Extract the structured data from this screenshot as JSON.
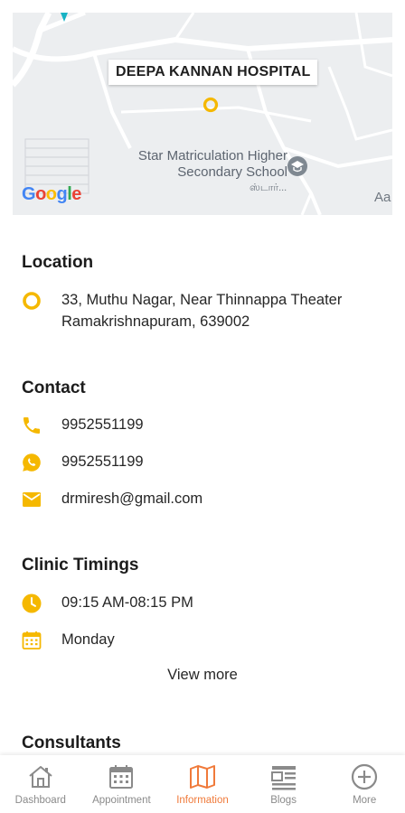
{
  "map": {
    "hospital_label": "DEEPA KANNAN HOSPITAL",
    "school_line1": "Star Matriculation Higher",
    "school_line2": "Secondary School",
    "school_tamil": "ஸ்டார்...",
    "edge_label": "Aa",
    "google": [
      "G",
      "o",
      "o",
      "g",
      "l",
      "e"
    ]
  },
  "location": {
    "title": "Location",
    "address_line1": "33, Muthu Nagar, Near Thinnappa Theater",
    "address_line2": "Ramakrishnapuram, 639002"
  },
  "contact": {
    "title": "Contact",
    "phone": "9952551199",
    "whatsapp": "9952551199",
    "email": "drmiresh@gmail.com"
  },
  "timings": {
    "title": "Clinic Timings",
    "hours": "09:15 AM-08:15 PM",
    "day": "Monday",
    "view_more": "View more"
  },
  "consultants": {
    "title": "Consultants"
  },
  "nav": {
    "items": [
      {
        "label": "Dashboard",
        "icon": "home-icon"
      },
      {
        "label": "Appointment",
        "icon": "calendar-icon"
      },
      {
        "label": "Information",
        "icon": "map-icon"
      },
      {
        "label": "Blogs",
        "icon": "blogs-icon"
      },
      {
        "label": "More",
        "icon": "plus-circle-icon"
      }
    ],
    "active_index": 2
  },
  "colors": {
    "accent": "#f5b800",
    "active": "#f07a3a",
    "inactive": "#8a8a8a"
  }
}
